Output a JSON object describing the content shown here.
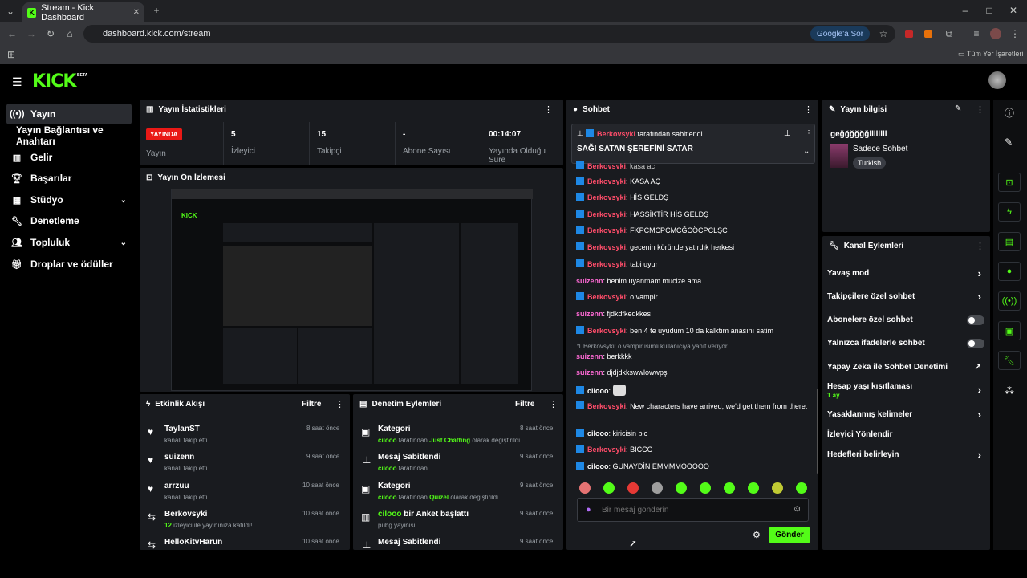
{
  "browser": {
    "tab_title": "Stream - Kick Dashboard",
    "url": "dashboard.kick.com/stream",
    "google_button": "Google'a Sor",
    "bookmarks_label": "Tüm Yer İşaretleri"
  },
  "brand": {
    "logo": "KICK",
    "beta": "BETA",
    "accent": "#53fc18"
  },
  "sidebar": {
    "items": [
      {
        "label": "Yayın",
        "icon": "broadcast-icon"
      },
      {
        "label": "Yayın Bağlantısı ve Anahtarı"
      },
      {
        "label": "Gelir",
        "icon": "chart-icon"
      },
      {
        "label": "Başarılar",
        "icon": "trophy-icon"
      },
      {
        "label": "Stüdyo",
        "icon": "studio-icon"
      },
      {
        "label": "Denetleme",
        "icon": "wrench-icon"
      },
      {
        "label": "Topluluk",
        "icon": "community-icon"
      },
      {
        "label": "Droplar ve ödüller",
        "icon": "gift-icon"
      }
    ]
  },
  "stats": {
    "title": "Yayın İstatistikleri",
    "live_badge": "YAYINDA",
    "live_label": "Yayın",
    "viewers": "5",
    "viewers_label": "İzleyici",
    "followers": "15",
    "followers_label": "Takipçi",
    "subs": "-",
    "subs_label": "Abone Sayısı",
    "uptime": "00:14:07",
    "uptime_label": "Yayında Olduğu Süre"
  },
  "preview": {
    "title": "Yayın Ön İzlemesi"
  },
  "activity": {
    "title": "Etkinlik Akışı",
    "filter": "Filtre",
    "items": [
      {
        "name": "TaylanST",
        "desc": "kanalı takip etti",
        "time": "8 saat önce"
      },
      {
        "name": "suizenn",
        "desc": "kanalı takip etti",
        "time": "9 saat önce"
      },
      {
        "name": "arrzuu",
        "desc": "kanalı takip etti",
        "time": "10 saat önce"
      },
      {
        "name": "Berkovsyki",
        "desc_count": "12",
        "desc": "izleyici ile yayınınıza katıldı!",
        "time": "10 saat önce"
      },
      {
        "name": "HelloKitvHarun",
        "desc": "",
        "time": "10 saat önce"
      }
    ]
  },
  "moderation": {
    "title": "Denetim Eylemleri",
    "filter": "Filtre",
    "items": [
      {
        "name": "Kategori",
        "user": "cilooo",
        "mid": "tarafından",
        "val": "Just Chatting",
        "end": "olarak değiştirildi",
        "time": "8 saat önce"
      },
      {
        "name": "Mesaj Sabitlendi",
        "user": "cilooo",
        "mid": "tarafından",
        "val": "",
        "end": "",
        "time": "9 saat önce"
      },
      {
        "name": "Kategori",
        "user": "cilooo",
        "mid": "tarafından",
        "val": "Quizel",
        "end": "olarak değiştirildi",
        "time": "9 saat önce"
      },
      {
        "name": "bir Anket başlattı",
        "user": "cilooo",
        "mid": "pubg yayinisi",
        "val": "",
        "end": "",
        "time": "9 saat önce"
      },
      {
        "name": "Mesaj Sabitlendi",
        "user": "",
        "mid": "",
        "val": "",
        "end": "",
        "time": "9 saat önce"
      }
    ]
  },
  "chat": {
    "title": "Sohbet",
    "pinned_by": "Berkovsyki",
    "pinned_suffix": "tarafından sabitlendi",
    "pinned_msg": "SAĞI SATAN ŞEREFİNİ SATAR",
    "messages": [
      {
        "user": "Berkovsyki",
        "text": "KASA AÇ"
      },
      {
        "user": "Berkovsyki",
        "text": "HİS GELDŞ"
      },
      {
        "user": "Berkovsyki",
        "text": "HASSİKTİR HİS GELDŞ"
      },
      {
        "user": "Berkovsyki",
        "text": "FKPCMCPCMCĞCÖCPCLŞC"
      },
      {
        "user": "Berkovsyki",
        "text": "gecenin köründe yatırdık herkesi"
      },
      {
        "user": "Berkovsyki",
        "text": "tabi uyur"
      },
      {
        "user": "suizenn",
        "text": "benim uyanmam mucize ama"
      },
      {
        "user": "Berkovsyki",
        "text": "o vampir"
      },
      {
        "user": "suizenn",
        "text": "fjdkdfkedkkes"
      },
      {
        "user": "Berkovsyki",
        "text": "ben 4 te uyudum 10 da kalktım anasını satim"
      },
      {
        "user": "suizenn",
        "text": "berkkkk"
      },
      {
        "user": "suizenn",
        "text": "djdjdkkswwlowwpşl"
      },
      {
        "user": "cilooo",
        "text": ""
      },
      {
        "user": "Berkovsyki",
        "text": "New characters have arrived, we'd get them from there."
      },
      {
        "user": "cilooo",
        "text": "kiricisin bic"
      },
      {
        "user": "Berkovsyki",
        "text": "BİCCC"
      },
      {
        "user": "cilooo",
        "text": "GUNAYDİN EMMMMOOOOO"
      }
    ],
    "reply_hint": "Berkovsyki: o vampir isimli kullanıcıya yanıt veriyor",
    "input_placeholder": "Bir mesaj gönderin",
    "send": "Gönder"
  },
  "info": {
    "title": "Yayın bilgisi",
    "stream_title": "geğğğğğğllllllll",
    "category": "Sadece Sohbet",
    "language": "Turkish"
  },
  "channel": {
    "title": "Kanal Eylemleri",
    "items": [
      "Yavaş mod",
      "Takipçilere özel sohbet",
      "Abonelere özel sohbet",
      "Yalnızca ifadelerle sohbet",
      "Yapay Zeka ile Sohbet Denetimi",
      "Hesap yaşı kısıtlaması",
      "Yasaklanmış kelimeler",
      "İzleyici Yönlendir",
      "Hedefleri belirleyin"
    ],
    "age_value": "1 ay"
  }
}
